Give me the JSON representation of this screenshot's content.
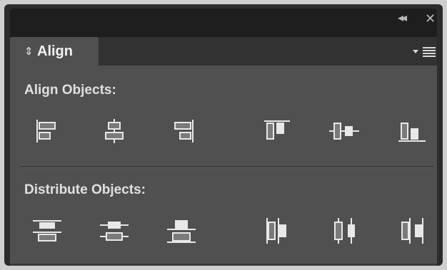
{
  "titlebar": {
    "collapse_icon": "double-chevron-left-icon",
    "collapse_glyph": "◂◂",
    "close_icon": "close-icon",
    "close_glyph": "✕"
  },
  "tab": {
    "arrows_glyph": "⇕",
    "label": "Align"
  },
  "panel_menu_icon": "panel-menu-icon",
  "align_section": {
    "title": "Align Objects:",
    "buttons": [
      "align-left-edges",
      "align-horizontal-centers",
      "align-right-edges",
      "align-top-edges",
      "align-vertical-centers",
      "align-bottom-edges"
    ]
  },
  "distribute_section": {
    "title": "Distribute Objects:",
    "buttons": [
      "distribute-top-edges",
      "distribute-vertical-centers",
      "distribute-bottom-edges",
      "distribute-left-edges",
      "distribute-horizontal-centers",
      "distribute-right-edges"
    ]
  },
  "colors": {
    "panel_bg": "#505050",
    "titlebar_bg": "#1e1e1e",
    "icon": "#e8e8e8",
    "text": "#e0e0e0"
  }
}
